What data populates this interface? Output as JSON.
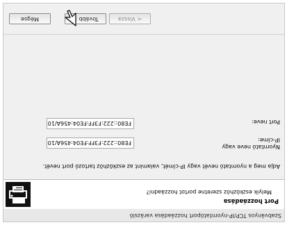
{
  "window": {
    "title": "Szabványos TCP/IP-nyomtatóport hozzáadása varázsló"
  },
  "header": {
    "title": "Port hozzáadása",
    "subtitle": "Melyik eszközhöz szeretne portot hozzáadni?",
    "icon": "printer-network-icon"
  },
  "instruction": "Adja meg a nyomtató nevét vagy IP-címét, valamint az eszközhöz tartozó port nevét.",
  "fields": {
    "printer_name_label_line1": "Nyomtató neve vagy",
    "printer_name_label_line2": "IP-címe:",
    "printer_name_value": "FE80::222:F3FF:FE04:456A/10",
    "port_name_label": "Port neve:",
    "port_name_value": "FE80::222:F3FF:FE04:456A/10"
  },
  "buttons": {
    "back": "< Vissza",
    "next": "Tovább >",
    "cancel": "Mégse"
  },
  "display": {
    "rotation_degrees": 180
  }
}
